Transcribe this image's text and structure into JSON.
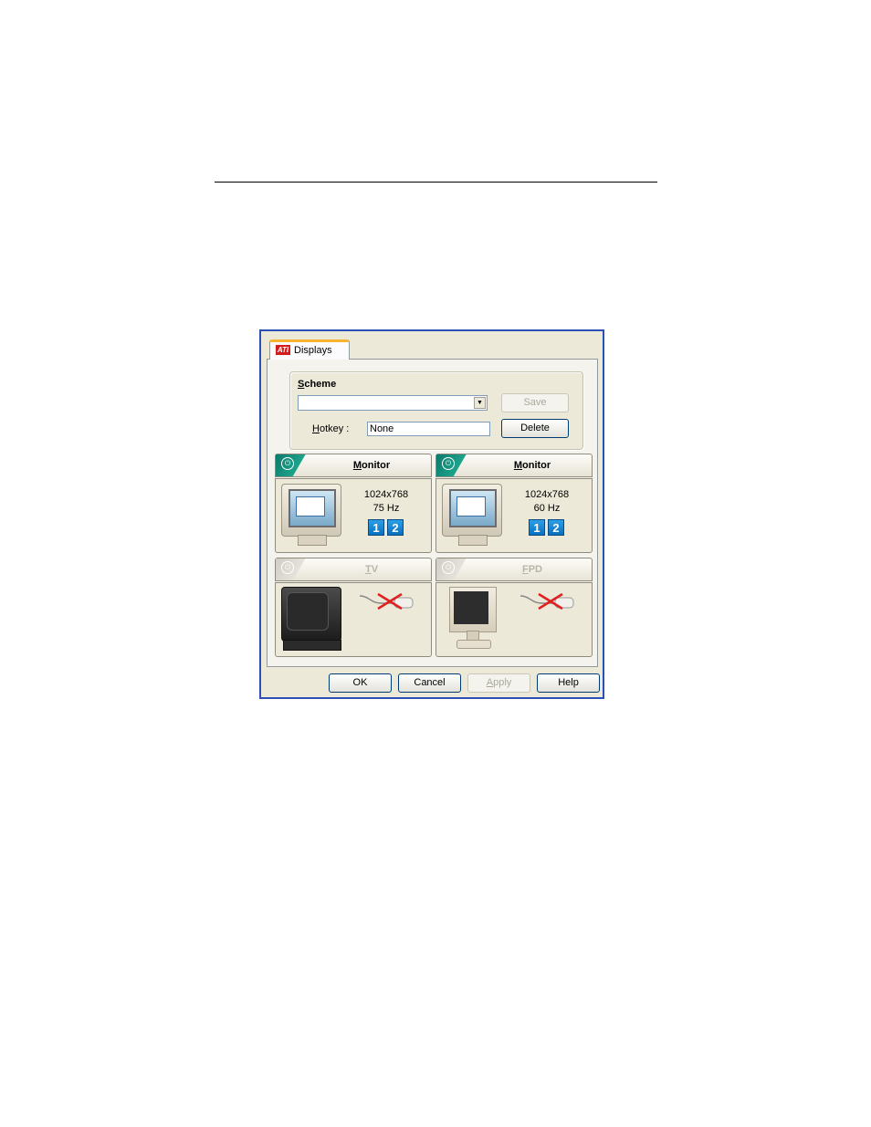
{
  "dialog": {
    "tab": {
      "logo_text": "ATI",
      "label": "Displays"
    },
    "scheme": {
      "title_underline": "S",
      "title_rest": "cheme",
      "selected_value": "",
      "hotkey_underline": "H",
      "hotkey_rest": "otkey :",
      "hotkey_value": "None",
      "save_label": "Save",
      "delete_label": "Delete"
    },
    "displays": [
      {
        "name_underline": "M",
        "name_rest": "onitor",
        "resolution": "1024x768",
        "refresh": "75 Hz",
        "enabled": true,
        "badges": [
          "1",
          "2"
        ]
      },
      {
        "name_underline": "M",
        "name_rest": "onitor",
        "resolution": "1024x768",
        "refresh": "60 Hz",
        "enabled": true,
        "badges": [
          "1",
          "2"
        ]
      },
      {
        "name_underline": "T",
        "name_rest": "V",
        "enabled": false,
        "status": "disconnected"
      },
      {
        "name_underline": "F",
        "name_rest": "PD",
        "enabled": false,
        "status": "disconnected"
      }
    ],
    "buttons": {
      "ok": "OK",
      "cancel": "Cancel",
      "apply_underline": "A",
      "apply_rest": "pply",
      "help": "Help"
    },
    "colors": {
      "border": "#2a4fb5",
      "active_power": "#1da38c",
      "badge": "#2d9fe6",
      "disconnected_x": "#e02020"
    }
  }
}
